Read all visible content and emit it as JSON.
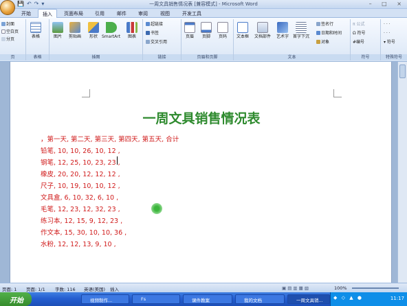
{
  "window": {
    "title": "一周文具销售情况表 [兼容模式] - Microsoft Word",
    "controls": "– □ ×"
  },
  "tabs": [
    "开始",
    "插入",
    "页面布局",
    "引用",
    "邮件",
    "审阅",
    "视图",
    "开发工具"
  ],
  "active_tab": "插入",
  "ribbon": {
    "pages": {
      "label": "页",
      "items": [
        "封面",
        "空白页",
        "分页"
      ]
    },
    "table": {
      "label": "表格",
      "button": "表格"
    },
    "illustrations": {
      "label": "插图",
      "buttons": [
        "图片",
        "剪贴画",
        "形状",
        "SmartArt",
        "图表"
      ]
    },
    "links": {
      "label": "链接",
      "items": [
        "超链接",
        "书签",
        "交叉引用"
      ]
    },
    "header_footer": {
      "label": "页眉和页脚",
      "buttons": [
        "页眉",
        "页脚",
        "页码"
      ]
    },
    "text": {
      "label": "文本",
      "buttons": [
        "文本框",
        "文档部件",
        "艺术字",
        "首字下沉"
      ],
      "items": [
        "签名行",
        "日期和时间",
        "对象"
      ]
    },
    "symbols": {
      "label": "符号",
      "items": [
        "公式",
        "符号",
        "编号"
      ]
    },
    "special": {
      "label": "特殊符号",
      "items": [
        "符号"
      ]
    }
  },
  "document": {
    "title": "一周文具销售情况表",
    "lines": [
      "，第一天, 第二天, 第三天, 第四天, 第五天, 合计",
      "铅笔, 10, 10, 26, 10, 12 ,",
      "钢笔, 12, 25, 10, 23, 23 ,",
      "橡皮, 20, 20, 12, 12, 12 ,",
      "尺子, 10, 19, 10, 10, 12 ,",
      "文具盒, 6, 10, 32, 6, 10 ,",
      "毛笔, 12, 23, 12, 32, 23 ,",
      "练习本, 12, 15, 9, 12, 23 ,",
      "作文本, 15, 30, 10, 10, 36 ,",
      "水粉, 12, 12, 13, 9, 10 ,"
    ]
  },
  "status": {
    "page": "页面: 1",
    "pages": "页面: 1/1",
    "words": "字数: 116",
    "lang": "英语(美国)",
    "mode": "插入",
    "zoom": "100%"
  },
  "taskbar": {
    "start": "开始",
    "items": [
      "视频制作...",
      "Fs",
      "课件教案",
      "我的文档",
      "一周文具销..."
    ],
    "active_index": 4,
    "clock": "11:17"
  },
  "colors": {
    "title_green": "#2e8a2e",
    "text_red": "#d01b1b",
    "ribbon_blue": "#dbe7f6"
  }
}
